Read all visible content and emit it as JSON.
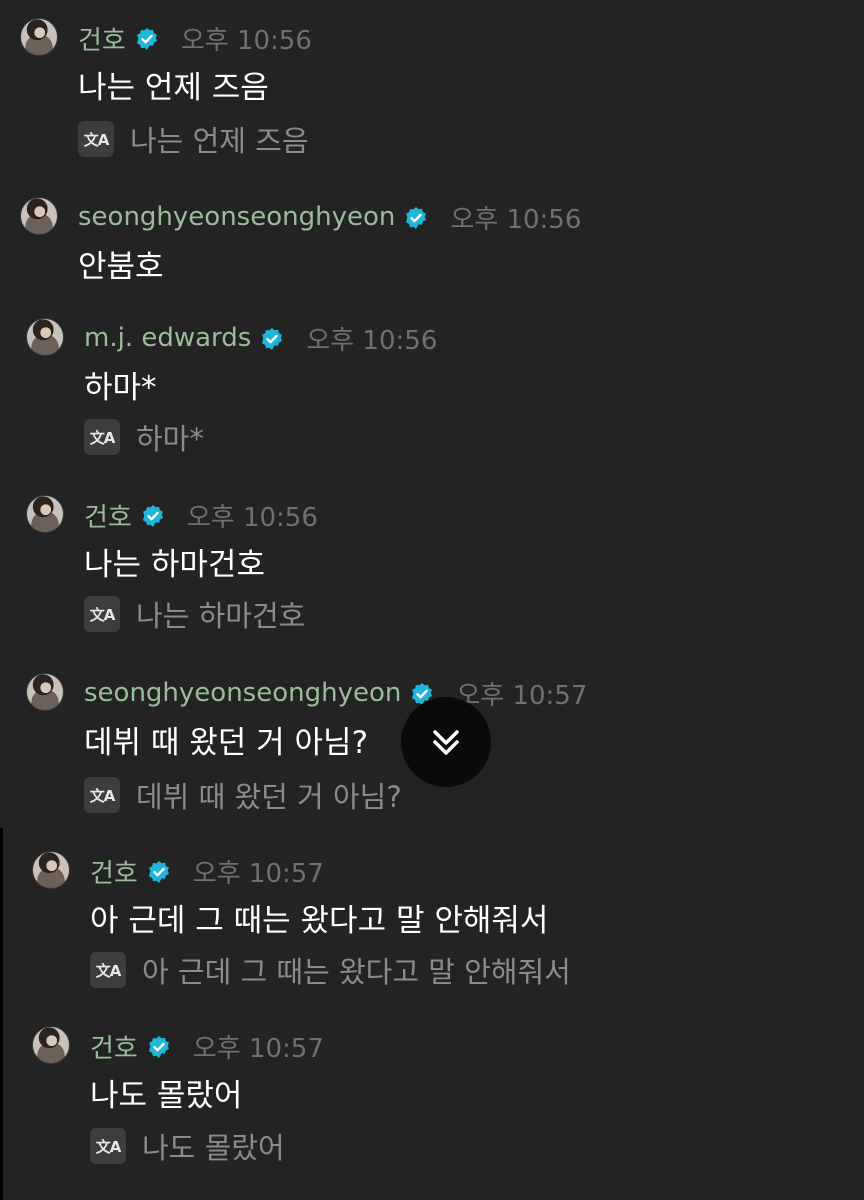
{
  "messages": [
    {
      "name": "건호",
      "time": "오후 10:56",
      "text": "나는 언제 즈음",
      "translation": "나는 언제 즈음"
    },
    {
      "name": "seonghyeonseonghyeon",
      "time": "오후 10:56",
      "text": "안붐호"
    },
    {
      "name": "m.j. edwards",
      "time": "오후 10:56",
      "text": "하마*",
      "translation": "하마*"
    },
    {
      "name": "건호",
      "time": "오후 10:56",
      "text": "나는 하마건호",
      "translation": "나는 하마건호"
    },
    {
      "name": "seonghyeonseonghyeon",
      "time": "오후 10:57",
      "text": "데뷔 때 왔던 거 아님?",
      "translation": "데뷔 때 왔던 거 아님?"
    },
    {
      "name": "건호",
      "time": "오후 10:57",
      "text": "아 근데 그 때는 왔다고 말 안해줘서",
      "translation": "아 근데 그 때는 왔다고 말 안해줘서"
    },
    {
      "name": "건호",
      "time": "오후 10:57",
      "text": "나도 몰랐어",
      "translation": "나도 몰랐어"
    }
  ],
  "translate_icon_label": "文A",
  "icons": {
    "verified": "verified-badge-icon",
    "translate": "translate-icon",
    "scroll": "chevrons-down-icon"
  },
  "colors": {
    "background": "#232323",
    "name": "#9bbc98",
    "verified": "#1fb6d9",
    "timestamp": "#707070",
    "body": "#ffffff",
    "translation": "#8b8b8b"
  }
}
